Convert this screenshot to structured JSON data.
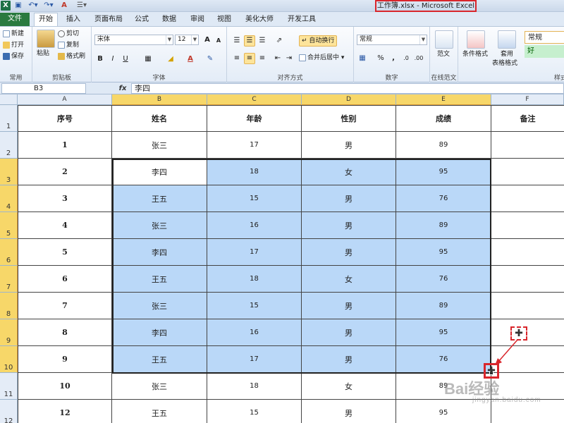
{
  "titlebar": {
    "window_title": "工作簿.xlsx - Microsoft Excel",
    "qa_icons": [
      "excel-logo-icon",
      "save-icon",
      "undo-icon",
      "redo-icon",
      "font-color-icon",
      "customize-icon"
    ]
  },
  "tabs": [
    "文件",
    "开始",
    "插入",
    "页面布局",
    "公式",
    "数据",
    "审阅",
    "视图",
    "美化大师",
    "开发工具"
  ],
  "ribbon": {
    "clipboard": {
      "label": "常用",
      "new": "新建",
      "open": "打开",
      "save": "保存"
    },
    "paste_group": {
      "label": "剪贴板",
      "paste": "粘贴",
      "cut": "剪切",
      "copy": "复制",
      "format_painter": "格式刷"
    },
    "font": {
      "label": "字体",
      "name": "宋体",
      "size": "12",
      "bold": "B",
      "italic": "I",
      "underline": "U",
      "grow": "A",
      "shrink": "A"
    },
    "alignment": {
      "label": "对齐方式",
      "wrap": "自动换行",
      "merge": "合并后居中"
    },
    "number": {
      "label": "数字",
      "format": "常规",
      "percent": "%",
      "comma": ","
    },
    "online": {
      "label": "在线范文",
      "template": "范文"
    },
    "styles": {
      "label": "样式",
      "cond_format": "条件格式",
      "table_format": "套用",
      "table_format2": "表格格式",
      "style_normal": "常规",
      "style_good": "好"
    }
  },
  "formula_bar": {
    "name_box": "B3",
    "fx": "fx",
    "content": "李四"
  },
  "columns": [
    "A",
    "B",
    "C",
    "D",
    "E",
    "F"
  ],
  "header_row": [
    "序号",
    "姓名",
    "年龄",
    "性别",
    "成绩",
    "备注"
  ],
  "rows": [
    {
      "row": "1"
    },
    {
      "row": "2",
      "cells": [
        "1",
        "张三",
        "17",
        "男",
        "89",
        ""
      ]
    },
    {
      "row": "3",
      "cells": [
        "2",
        "李四",
        "18",
        "女",
        "95",
        ""
      ]
    },
    {
      "row": "4",
      "cells": [
        "3",
        "王五",
        "15",
        "男",
        "76",
        ""
      ]
    },
    {
      "row": "5",
      "cells": [
        "4",
        "张三",
        "16",
        "男",
        "89",
        ""
      ]
    },
    {
      "row": "6",
      "cells": [
        "5",
        "李四",
        "17",
        "男",
        "95",
        ""
      ]
    },
    {
      "row": "7",
      "cells": [
        "6",
        "王五",
        "18",
        "女",
        "76",
        ""
      ]
    },
    {
      "row": "8",
      "cells": [
        "7",
        "张三",
        "15",
        "男",
        "89",
        ""
      ]
    },
    {
      "row": "9",
      "cells": [
        "8",
        "李四",
        "16",
        "男",
        "95",
        ""
      ]
    },
    {
      "row": "10",
      "cells": [
        "9",
        "王五",
        "17",
        "男",
        "76",
        ""
      ]
    },
    {
      "row": "11",
      "cells": [
        "10",
        "张三",
        "18",
        "女",
        "89",
        ""
      ]
    },
    {
      "row": "12",
      "cells": [
        "12",
        "王五",
        "15",
        "男",
        "95",
        ""
      ]
    }
  ],
  "selection": {
    "active_cell": "B3",
    "range": "B3:E10"
  },
  "watermark": {
    "brand": "Bai经验",
    "sub": "jingyan.baidu.com"
  },
  "colors": {
    "selection": "#bad8f8",
    "header_selected": "#f7d769",
    "file_tab": "#2a7a3f",
    "annotation": "#d9262c"
  }
}
